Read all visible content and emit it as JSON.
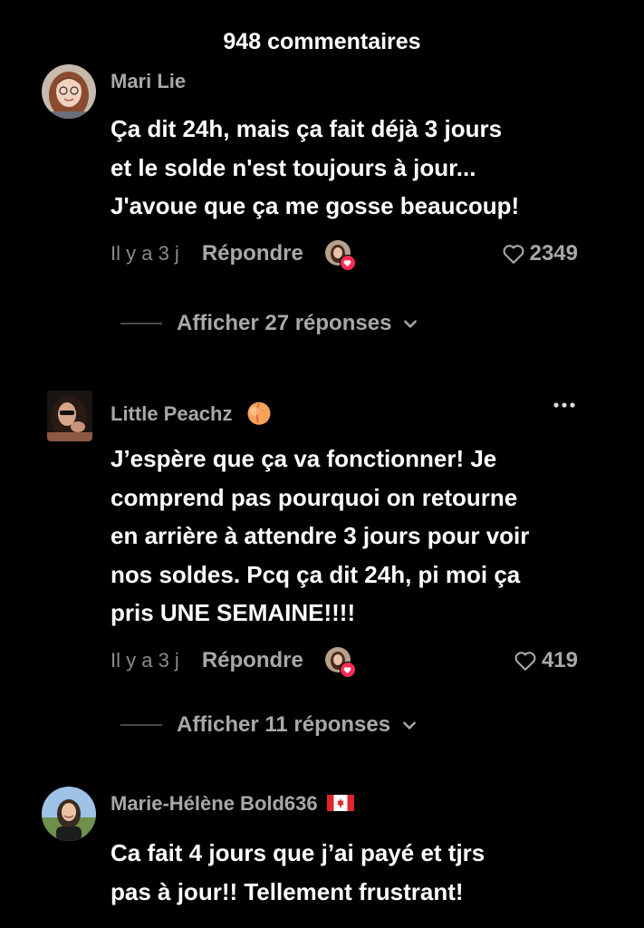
{
  "header": {
    "title": "948 commentaires"
  },
  "comments": [
    {
      "username": "Mari Lie",
      "text": "Ça dit 24h, mais ça fait déjà 3 jours\net le solde n'est toujours à jour...\nJ'avoue que ça me gosse beaucoup!",
      "time": "Il y a 3 j",
      "reply_label": "Répondre",
      "likes": "2349",
      "replies_label": "Afficher 27 réponses"
    },
    {
      "username": "Little Peachz",
      "text": "J’espère que ça va fonctionner! Je\ncomprend pas pourquoi on retourne\nen arrière à attendre 3 jours pour voir\nnos soldes. Pcq ça dit 24h, pi moi ça\npris UNE SEMAINE!!!!",
      "time": "Il y a 3 j",
      "reply_label": "Répondre",
      "likes": "419",
      "replies_label": "Afficher 11 réponses"
    },
    {
      "username": "Marie-Hélène Bold636",
      "text": "Ca fait 4 jours que j’ai payé et tjrs\npas à jour!! Tellement frustrant!"
    }
  ],
  "icons": {
    "heart": "heart-outline-icon",
    "chevron": "chevron-down-icon",
    "more": "more-dots-icon",
    "peach": "peach-emoji-icon",
    "flag": "canada-flag-icon"
  },
  "colors": {
    "background": "#000000",
    "like_badge": "#fe2c55",
    "muted": "#a8a8a8"
  }
}
